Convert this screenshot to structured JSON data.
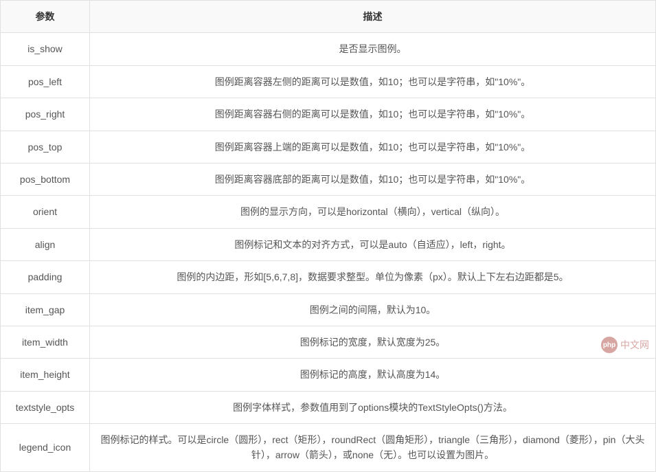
{
  "table": {
    "headers": {
      "param": "参数",
      "description": "描述"
    },
    "rows": [
      {
        "param": "is_show",
        "description": "是否显示图例。"
      },
      {
        "param": "pos_left",
        "description": "图例距离容器左侧的距离可以是数值，如10；也可以是字符串，如\"10%\"。"
      },
      {
        "param": "pos_right",
        "description": "图例距离容器右侧的距离可以是数值，如10；也可以是字符串，如\"10%\"。"
      },
      {
        "param": "pos_top",
        "description": "图例距离容器上端的距离可以是数值，如10；也可以是字符串，如\"10%\"。"
      },
      {
        "param": "pos_bottom",
        "description": "图例距离容器底部的距离可以是数值，如10；也可以是字符串，如\"10%\"。"
      },
      {
        "param": "orient",
        "description": "图例的显示方向，可以是horizontal（横向），vertical（纵向）。"
      },
      {
        "param": "align",
        "description": "图例标记和文本的对齐方式，可以是auto（自适应），left，right。"
      },
      {
        "param": "padding",
        "description": "图例的内边距，形如[5,6,7,8]，数据要求整型。单位为像素（px）。默认上下左右边距都是5。"
      },
      {
        "param": "item_gap",
        "description": "图例之间的间隔，默认为10。"
      },
      {
        "param": "item_width",
        "description": "图例标记的宽度，默认宽度为25。"
      },
      {
        "param": "item_height",
        "description": "图例标记的高度，默认高度为14。"
      },
      {
        "param": "textstyle_opts",
        "description": "图例字体样式，参数值用到了options模块的TextStyleOpts()方法。"
      },
      {
        "param": "legend_icon",
        "description": "图例标记的样式。可以是circle（圆形），rect（矩形），roundRect（圆角矩形），triangle（三角形），diamond（菱形），pin（大头针），arrow（箭头），或none（无）。也可以设置为图片。"
      }
    ]
  },
  "watermark": {
    "logo_text": "php",
    "text": "中文网"
  }
}
